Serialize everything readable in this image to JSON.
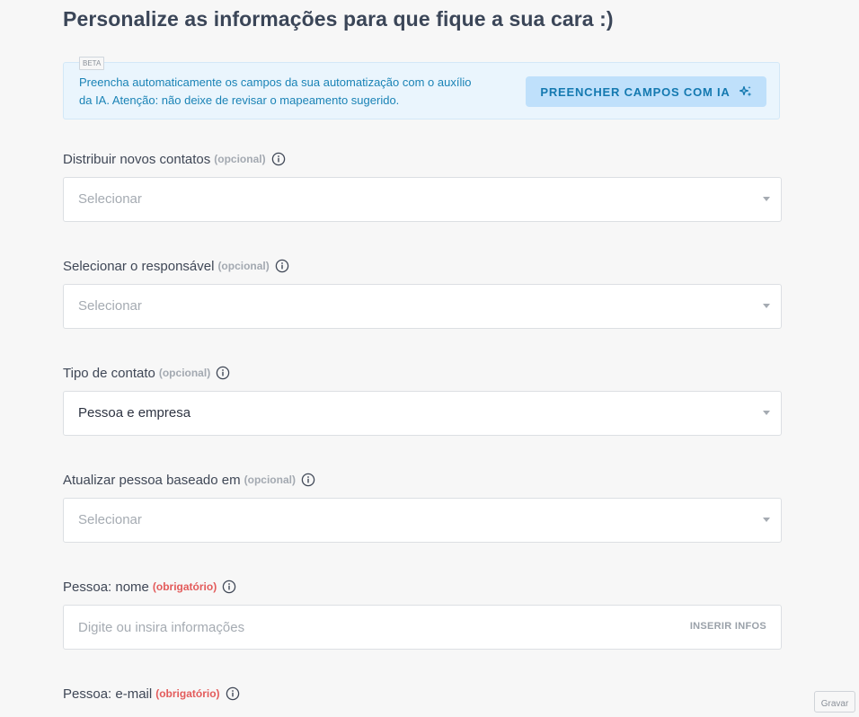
{
  "page": {
    "title": "Personalize as informações para que fique a sua cara :)"
  },
  "ai_banner": {
    "badge": "BETA",
    "text": "Preencha automaticamente os campos da sua automatização com o auxílio da IA. Atenção: não deixe de revisar o mapeamento sugerido.",
    "button_label": "PREENCHER CAMPOS COM IA",
    "button_icon": "sparkles-icon"
  },
  "fields": [
    {
      "label": "Distribuir novos contatos",
      "tag": "(opcional)",
      "tag_type": "optional",
      "control": "select",
      "placeholder": "Selecionar",
      "value": ""
    },
    {
      "label": "Selecionar o responsável",
      "tag": "(opcional)",
      "tag_type": "optional",
      "control": "select",
      "placeholder": "Selecionar",
      "value": ""
    },
    {
      "label": "Tipo de contato",
      "tag": "(opcional)",
      "tag_type": "optional",
      "control": "select",
      "placeholder": "",
      "value": "Pessoa e empresa"
    },
    {
      "label": "Atualizar pessoa baseado em",
      "tag": "(opcional)",
      "tag_type": "optional",
      "control": "select",
      "placeholder": "Selecionar",
      "value": ""
    },
    {
      "label": "Pessoa: nome",
      "tag": "(obrigatório)",
      "tag_type": "required",
      "control": "text",
      "placeholder": "Digite ou insira informações",
      "action_label": "INSERIR INFOS"
    },
    {
      "label": "Pessoa: e-mail",
      "tag": "(obrigatório)",
      "tag_type": "required",
      "control": "text"
    }
  ],
  "footer": {
    "record_button": "Gravar"
  },
  "colors": {
    "accent": "#1479b0",
    "banner_bg": "#eaf5fd",
    "ai_button_bg": "#bfe0fb",
    "required": "#e35b5b",
    "optional": "#a3a9b1"
  }
}
